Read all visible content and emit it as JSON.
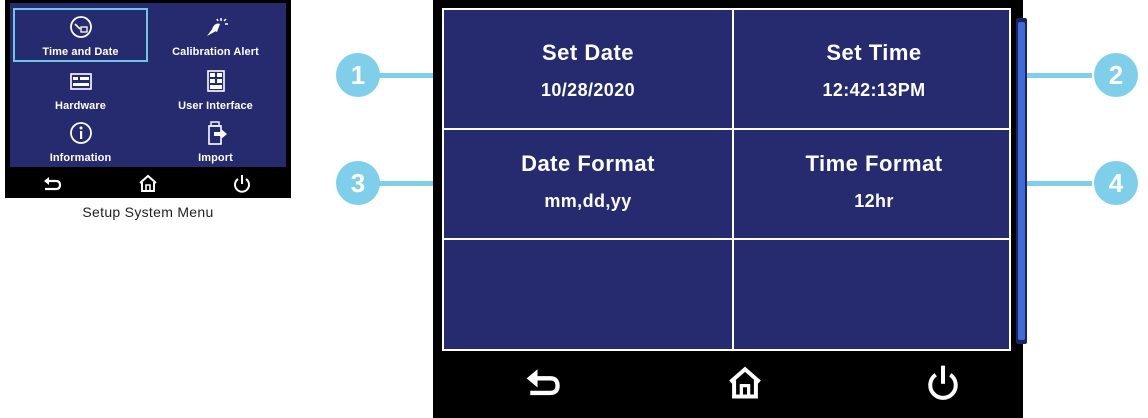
{
  "mini_menu": {
    "items": [
      {
        "label": "Time and Date",
        "icon": "clock-icon",
        "selected": true
      },
      {
        "label": "Calibration Alert",
        "icon": "calibration-icon"
      },
      {
        "label": "Hardware",
        "icon": "hardware-icon"
      },
      {
        "label": "User Interface",
        "icon": "interface-icon"
      },
      {
        "label": "Information",
        "icon": "info-icon"
      },
      {
        "label": "Import",
        "icon": "import-icon"
      }
    ],
    "caption": "Setup System Menu"
  },
  "time_date_screen": {
    "cells": [
      {
        "title": "Set Date",
        "value": "10/28/2020"
      },
      {
        "title": "Set Time",
        "value": "12:42:13PM"
      },
      {
        "title": "Date Format",
        "value": "mm,dd,yy"
      },
      {
        "title": "Time Format",
        "value": "12hr"
      }
    ]
  },
  "callouts": [
    "1",
    "2",
    "3",
    "4"
  ],
  "nav": {
    "back": "back-icon",
    "home": "home-icon",
    "power": "power-icon"
  },
  "colors": {
    "panel": "#262b70",
    "accent": "#7fcfeb",
    "scroll_thumb": "#3d6bd8"
  }
}
